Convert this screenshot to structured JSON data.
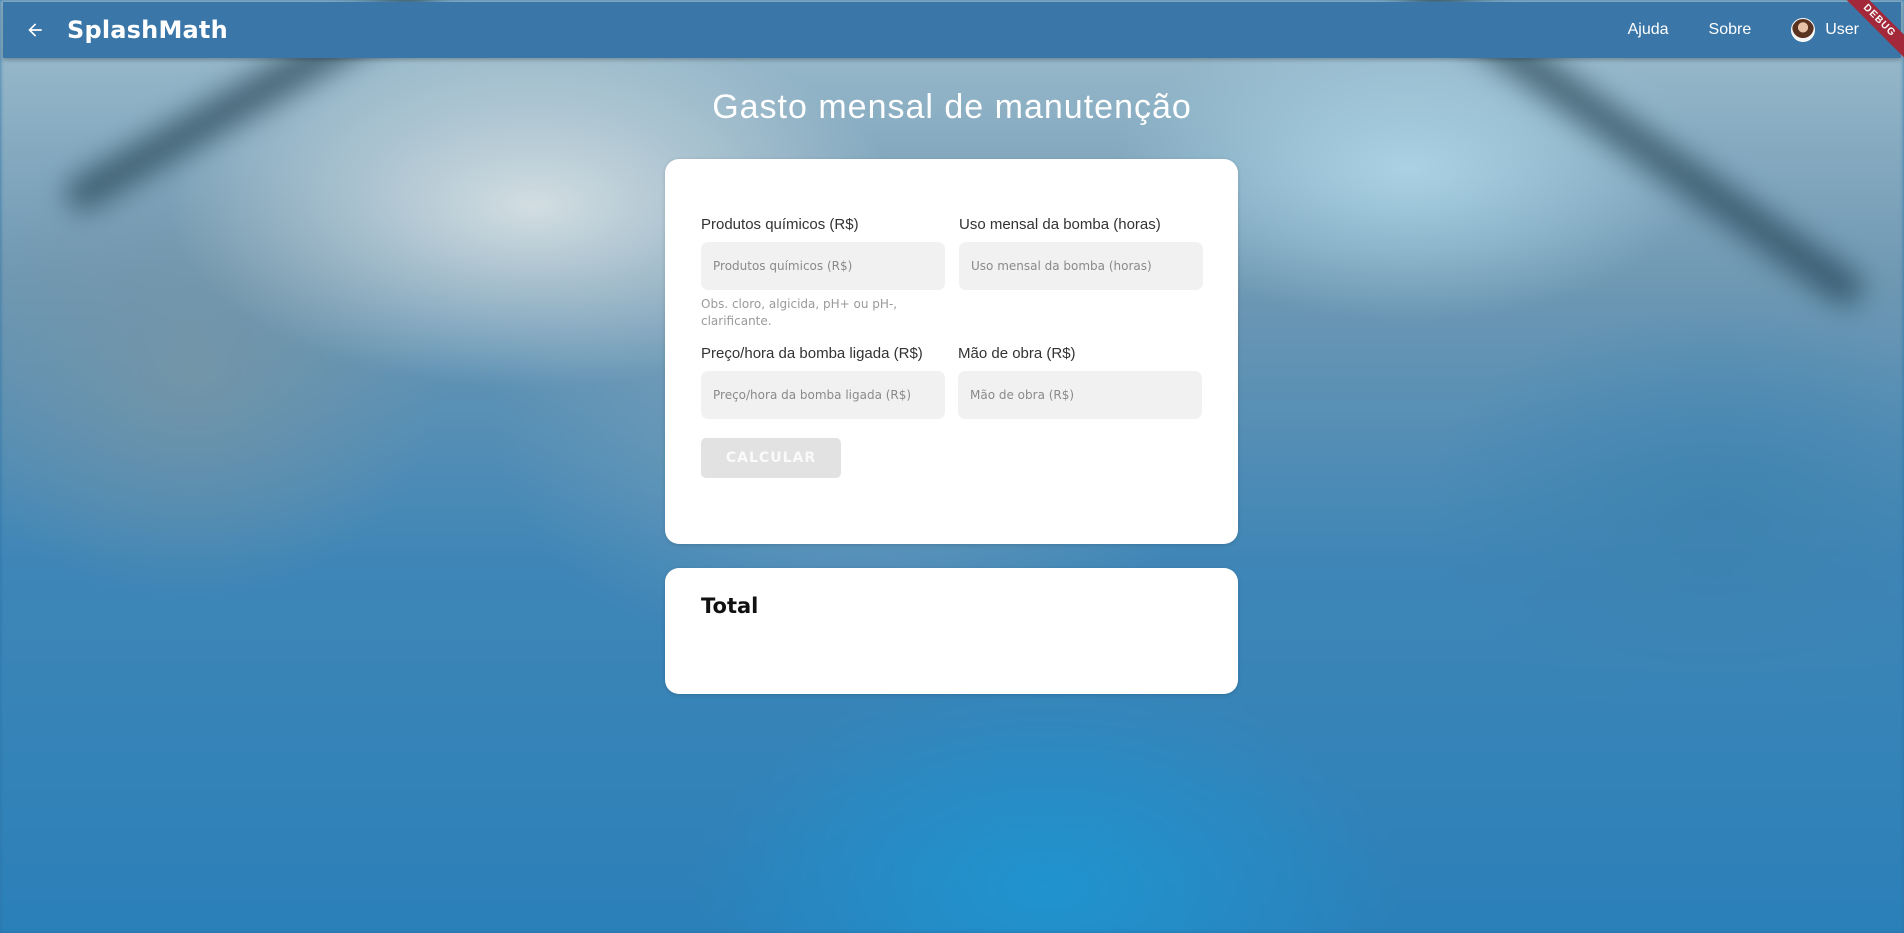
{
  "app": {
    "brand": "SplashMath",
    "nav": {
      "help": "Ajuda",
      "about": "Sobre"
    },
    "user_name": "User",
    "debug_banner": "DEBUG"
  },
  "page": {
    "title": "Gasto mensal de manutenção"
  },
  "form": {
    "chemicals": {
      "label": "Produtos químicos (R$)",
      "placeholder": "Produtos químicos (R$)",
      "value": "",
      "hint": "Obs. cloro, algicida, pH+ ou pH-, clarificante."
    },
    "pump_usage": {
      "label": "Uso mensal da bomba (horas)",
      "placeholder": "Uso mensal da bomba (horas)",
      "value": ""
    },
    "pump_price": {
      "label": "Preço/hora da bomba ligada (R$)",
      "placeholder": "Preço/hora da bomba ligada (R$)",
      "value": ""
    },
    "labor": {
      "label": "Mão de obra (R$)",
      "placeholder": "Mão de obra (R$)",
      "value": ""
    },
    "calculate_label": "CALCULAR"
  },
  "result": {
    "title": "Total",
    "value": ""
  },
  "colors": {
    "appbar": "#3a77a8",
    "button_disabled": "#e2e2e2",
    "debug_banner": "#a2283a"
  },
  "icons": {
    "back": "arrow-back-icon",
    "avatar": "avatar-icon"
  }
}
